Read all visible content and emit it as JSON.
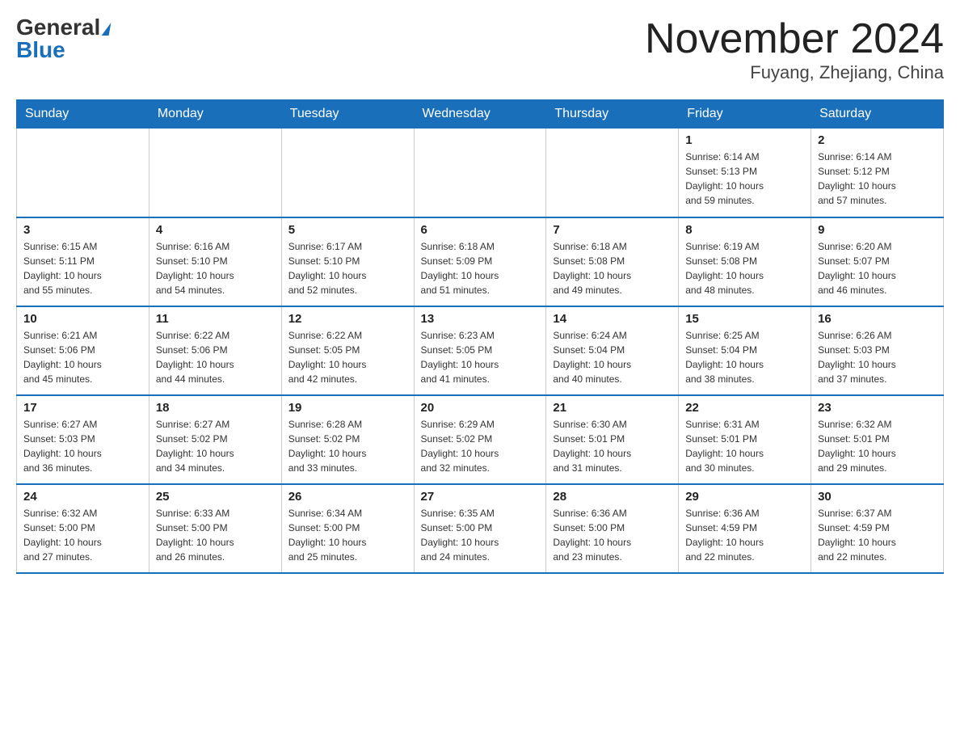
{
  "logo": {
    "general": "General",
    "blue": "Blue"
  },
  "header": {
    "month": "November 2024",
    "location": "Fuyang, Zhejiang, China"
  },
  "weekdays": [
    "Sunday",
    "Monday",
    "Tuesday",
    "Wednesday",
    "Thursday",
    "Friday",
    "Saturday"
  ],
  "weeks": [
    [
      {
        "day": "",
        "info": ""
      },
      {
        "day": "",
        "info": ""
      },
      {
        "day": "",
        "info": ""
      },
      {
        "day": "",
        "info": ""
      },
      {
        "day": "",
        "info": ""
      },
      {
        "day": "1",
        "info": "Sunrise: 6:14 AM\nSunset: 5:13 PM\nDaylight: 10 hours\nand 59 minutes."
      },
      {
        "day": "2",
        "info": "Sunrise: 6:14 AM\nSunset: 5:12 PM\nDaylight: 10 hours\nand 57 minutes."
      }
    ],
    [
      {
        "day": "3",
        "info": "Sunrise: 6:15 AM\nSunset: 5:11 PM\nDaylight: 10 hours\nand 55 minutes."
      },
      {
        "day": "4",
        "info": "Sunrise: 6:16 AM\nSunset: 5:10 PM\nDaylight: 10 hours\nand 54 minutes."
      },
      {
        "day": "5",
        "info": "Sunrise: 6:17 AM\nSunset: 5:10 PM\nDaylight: 10 hours\nand 52 minutes."
      },
      {
        "day": "6",
        "info": "Sunrise: 6:18 AM\nSunset: 5:09 PM\nDaylight: 10 hours\nand 51 minutes."
      },
      {
        "day": "7",
        "info": "Sunrise: 6:18 AM\nSunset: 5:08 PM\nDaylight: 10 hours\nand 49 minutes."
      },
      {
        "day": "8",
        "info": "Sunrise: 6:19 AM\nSunset: 5:08 PM\nDaylight: 10 hours\nand 48 minutes."
      },
      {
        "day": "9",
        "info": "Sunrise: 6:20 AM\nSunset: 5:07 PM\nDaylight: 10 hours\nand 46 minutes."
      }
    ],
    [
      {
        "day": "10",
        "info": "Sunrise: 6:21 AM\nSunset: 5:06 PM\nDaylight: 10 hours\nand 45 minutes."
      },
      {
        "day": "11",
        "info": "Sunrise: 6:22 AM\nSunset: 5:06 PM\nDaylight: 10 hours\nand 44 minutes."
      },
      {
        "day": "12",
        "info": "Sunrise: 6:22 AM\nSunset: 5:05 PM\nDaylight: 10 hours\nand 42 minutes."
      },
      {
        "day": "13",
        "info": "Sunrise: 6:23 AM\nSunset: 5:05 PM\nDaylight: 10 hours\nand 41 minutes."
      },
      {
        "day": "14",
        "info": "Sunrise: 6:24 AM\nSunset: 5:04 PM\nDaylight: 10 hours\nand 40 minutes."
      },
      {
        "day": "15",
        "info": "Sunrise: 6:25 AM\nSunset: 5:04 PM\nDaylight: 10 hours\nand 38 minutes."
      },
      {
        "day": "16",
        "info": "Sunrise: 6:26 AM\nSunset: 5:03 PM\nDaylight: 10 hours\nand 37 minutes."
      }
    ],
    [
      {
        "day": "17",
        "info": "Sunrise: 6:27 AM\nSunset: 5:03 PM\nDaylight: 10 hours\nand 36 minutes."
      },
      {
        "day": "18",
        "info": "Sunrise: 6:27 AM\nSunset: 5:02 PM\nDaylight: 10 hours\nand 34 minutes."
      },
      {
        "day": "19",
        "info": "Sunrise: 6:28 AM\nSunset: 5:02 PM\nDaylight: 10 hours\nand 33 minutes."
      },
      {
        "day": "20",
        "info": "Sunrise: 6:29 AM\nSunset: 5:02 PM\nDaylight: 10 hours\nand 32 minutes."
      },
      {
        "day": "21",
        "info": "Sunrise: 6:30 AM\nSunset: 5:01 PM\nDaylight: 10 hours\nand 31 minutes."
      },
      {
        "day": "22",
        "info": "Sunrise: 6:31 AM\nSunset: 5:01 PM\nDaylight: 10 hours\nand 30 minutes."
      },
      {
        "day": "23",
        "info": "Sunrise: 6:32 AM\nSunset: 5:01 PM\nDaylight: 10 hours\nand 29 minutes."
      }
    ],
    [
      {
        "day": "24",
        "info": "Sunrise: 6:32 AM\nSunset: 5:00 PM\nDaylight: 10 hours\nand 27 minutes."
      },
      {
        "day": "25",
        "info": "Sunrise: 6:33 AM\nSunset: 5:00 PM\nDaylight: 10 hours\nand 26 minutes."
      },
      {
        "day": "26",
        "info": "Sunrise: 6:34 AM\nSunset: 5:00 PM\nDaylight: 10 hours\nand 25 minutes."
      },
      {
        "day": "27",
        "info": "Sunrise: 6:35 AM\nSunset: 5:00 PM\nDaylight: 10 hours\nand 24 minutes."
      },
      {
        "day": "28",
        "info": "Sunrise: 6:36 AM\nSunset: 5:00 PM\nDaylight: 10 hours\nand 23 minutes."
      },
      {
        "day": "29",
        "info": "Sunrise: 6:36 AM\nSunset: 4:59 PM\nDaylight: 10 hours\nand 22 minutes."
      },
      {
        "day": "30",
        "info": "Sunrise: 6:37 AM\nSunset: 4:59 PM\nDaylight: 10 hours\nand 22 minutes."
      }
    ]
  ]
}
